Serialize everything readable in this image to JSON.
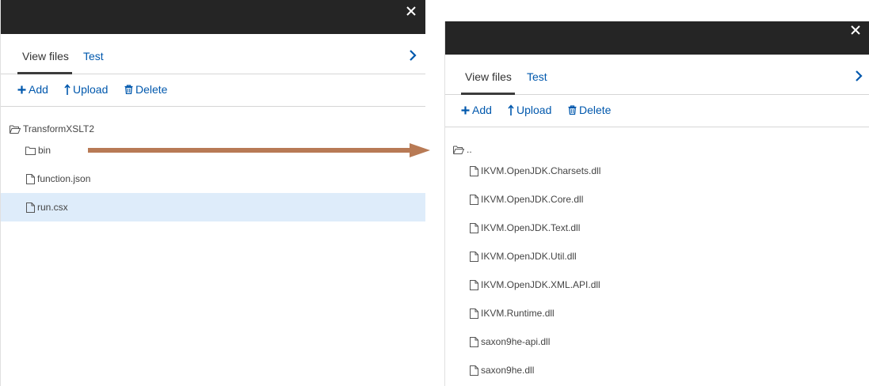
{
  "left_panel": {
    "close_icon": "close-icon",
    "tabs": [
      {
        "label": "View files",
        "active": true
      },
      {
        "label": "Test",
        "active": false
      }
    ],
    "toolbar": {
      "add_label": "Add",
      "upload_label": "Upload",
      "delete_label": "Delete"
    },
    "tree": {
      "root": "TransformXSLT2",
      "items": [
        {
          "label": "bin",
          "type": "folder",
          "selected": false
        },
        {
          "label": "function.json",
          "type": "file",
          "selected": false
        },
        {
          "label": "run.csx",
          "type": "file",
          "selected": true
        }
      ]
    }
  },
  "right_panel": {
    "close_icon": "close-icon",
    "tabs": [
      {
        "label": "View files",
        "active": true
      },
      {
        "label": "Test",
        "active": false
      }
    ],
    "toolbar": {
      "add_label": "Add",
      "upload_label": "Upload",
      "delete_label": "Delete"
    },
    "tree": {
      "parent": "..",
      "items": [
        {
          "label": "IKVM.OpenJDK.Charsets.dll",
          "type": "file"
        },
        {
          "label": "IKVM.OpenJDK.Core.dll",
          "type": "file"
        },
        {
          "label": "IKVM.OpenJDK.Text.dll",
          "type": "file"
        },
        {
          "label": "IKVM.OpenJDK.Util.dll",
          "type": "file"
        },
        {
          "label": "IKVM.OpenJDK.XML.API.dll",
          "type": "file"
        },
        {
          "label": "IKVM.Runtime.dll",
          "type": "file"
        },
        {
          "label": "saxon9he-api.dll",
          "type": "file"
        },
        {
          "label": "saxon9he.dll",
          "type": "file"
        }
      ]
    }
  },
  "colors": {
    "titlebar": "#252525",
    "link": "#0058ad",
    "selected_row": "#deecfa",
    "arrow": "#b87a55"
  }
}
